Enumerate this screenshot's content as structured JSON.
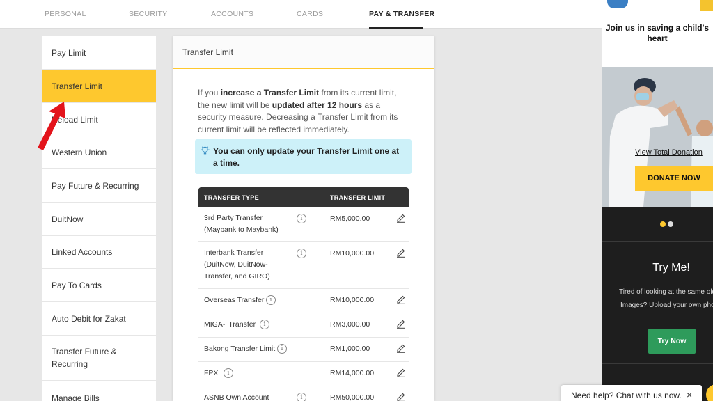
{
  "nav": {
    "tabs": [
      "PERSONAL",
      "SECURITY",
      "ACCOUNTS",
      "CARDS",
      "PAY & TRANSFER"
    ],
    "active": "PAY & TRANSFER"
  },
  "sidebar": {
    "items": [
      {
        "label": "Pay Limit"
      },
      {
        "label": "Transfer Limit",
        "active": true
      },
      {
        "label": "Reload Limit"
      },
      {
        "label": "Western Union"
      },
      {
        "label": "Pay Future & Recurring"
      },
      {
        "label": "DuitNow"
      },
      {
        "label": "Linked Accounts"
      },
      {
        "label": "Pay To Cards"
      },
      {
        "label": "Auto Debit for Zakat"
      },
      {
        "label": "Transfer Future & Recurring"
      },
      {
        "label": "Manage Bills"
      }
    ]
  },
  "panel": {
    "title": "Transfer Limit",
    "intro": {
      "p1": "If you ",
      "b1": "increase a Transfer Limit",
      "p2": " from its current limit, the new limit will be ",
      "b2": "updated after 12 hours",
      "p3": " as a security measure. Decreasing a Transfer Limit from its current limit will be reflected immediately."
    },
    "note": "You can only update your Transfer Limit one at a time.",
    "table": {
      "headers": [
        "TRANSFER TYPE",
        "TRANSFER LIMIT"
      ],
      "rows": [
        {
          "type": "3rd Party Transfer (Maybank to Maybank)",
          "limit": "RM5,000.00"
        },
        {
          "type": "Interbank Transfer (DuitNow, DuitNow-Transfer, and GIRO)",
          "limit": "RM10,000.00"
        },
        {
          "type": "Overseas Transfer",
          "limit": "RM10,000.00"
        },
        {
          "type": "MIGA-i Transfer",
          "limit": "RM3,000.00"
        },
        {
          "type": "Bakong Transfer Limit",
          "limit": "RM1,000.00"
        },
        {
          "type": "FPX",
          "limit": "RM14,000.00"
        },
        {
          "type": "ASNB Own Account",
          "limit": "RM50,000.00"
        }
      ]
    }
  },
  "ad": {
    "title": "Join us in saving a child's heart",
    "link": "View Total Donation",
    "donate_button": "DONATE NOW",
    "try_title": "Try Me!",
    "try_text": "Tired of looking at the same old Security Images? Upload your own photo today!",
    "try_button": "Try Now"
  },
  "chat": {
    "label": "Need help? Chat with us now.",
    "close": "×"
  },
  "colors": {
    "accent": "#fec82e",
    "note_bg": "#cdf1f9",
    "header_dark": "#333333",
    "try_button": "#2e9b5b"
  }
}
